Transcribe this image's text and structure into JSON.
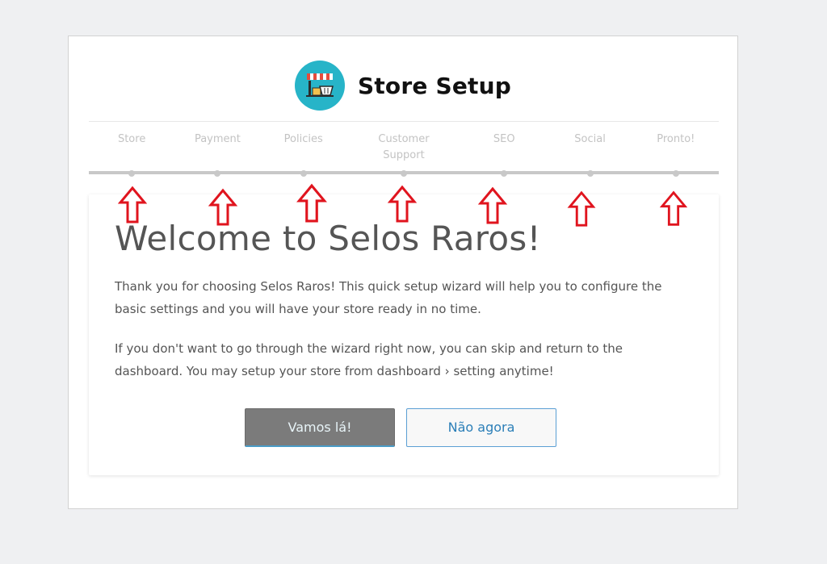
{
  "header": {
    "title": "Store Setup",
    "logo_icon": "storefront-icon"
  },
  "steps": [
    {
      "label": "Store"
    },
    {
      "label": "Payment"
    },
    {
      "label": "Policies"
    },
    {
      "label": "Customer Support"
    },
    {
      "label": "SEO"
    },
    {
      "label": "Social"
    },
    {
      "label": "Pronto!"
    }
  ],
  "main": {
    "heading": "Welcome to Selos Raros!",
    "paragraph1": "Thank you for choosing Selos Raros! This quick setup wizard will help you to configure the basic settings and you will have your store ready in no time.",
    "paragraph2": "If you don't want to go through the wizard right now, you can skip and return to the dashboard. You may setup your store from dashboard › setting anytime!",
    "primary_button": "Vamos lá!",
    "secondary_button": "Não agora"
  },
  "annotations": {
    "arrow_color": "#e0141e",
    "arrow_icon": "up-arrow-icon"
  },
  "colors": {
    "logo_bg": "#27b4c8",
    "page_bg": "#eff0f2",
    "primary_button_bg": "#7b7b7b",
    "secondary_button_text": "#2c7fb8"
  }
}
